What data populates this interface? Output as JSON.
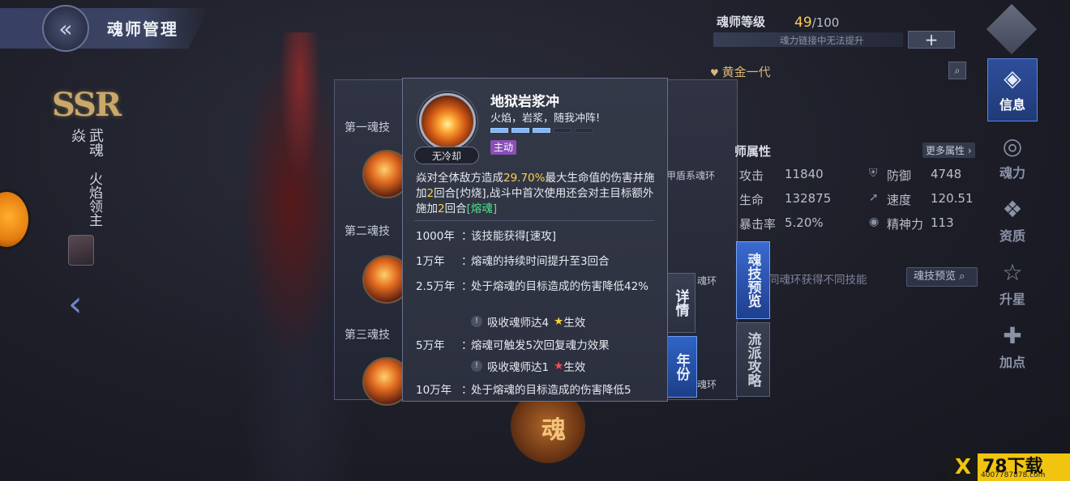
{
  "header": {
    "title": "魂师管理",
    "back_icon": "chevron-left-icon"
  },
  "character": {
    "rarity": "SSR",
    "name": "焱",
    "spirit_label": "武魂",
    "spirit_name": "火焰领主"
  },
  "skill_panel": {
    "slots": [
      {
        "label": "第一魂技"
      },
      {
        "label": "第二魂技"
      },
      {
        "label": "第三魂技"
      }
    ],
    "ring_labels": [
      "甲盾系魂环",
      "魂环",
      "魂环"
    ],
    "detail_tab": "详情",
    "year_tab": "年份"
  },
  "popup": {
    "cooldown": "无冷却",
    "name": "地狱岩浆冲",
    "quote": "火焰，岩浆，随我冲阵!",
    "level_filled": 3,
    "level_total": 5,
    "type_tag": "主动",
    "desc": {
      "part1": "焱对全体敌方造成",
      "pct": "29.70%",
      "part2": "最大生命值的伤害并施加",
      "num1": "2",
      "part3": "回合[灼烧],战斗中首次使用还会对主目标额外施加",
      "num2": "2",
      "part4": "回合",
      "status": "[熔魂]"
    },
    "years": [
      {
        "key": "1000年",
        "text": "该技能获得[速攻]"
      },
      {
        "key": "1万年",
        "text": "熔魂的持续时间提升至3回合"
      },
      {
        "key": "2.5万年",
        "text": "处于熔魂的目标造成的伤害降低42%",
        "req": "吸收魂师达4",
        "req_suffix": "生效",
        "star": "gold"
      },
      {
        "key": "5万年",
        "text": "熔魂可触发5次回复魂力效果",
        "req": "吸收魂师达1",
        "req_suffix": "生效",
        "star": "red"
      },
      {
        "key": "10万年",
        "text": "处于熔魂的目标造成的伤害降低5"
      }
    ],
    "colon": "：",
    "info_mark": "!",
    "star_glyph": "★"
  },
  "right_panel": {
    "level_label": "魂师等级",
    "level_current": "49",
    "level_max": "/100",
    "level_hint": "魂力链接中无法提升",
    "add_glyph": "+",
    "generation": "黄金一代",
    "attr_title": "师属性",
    "more_attr": "更多属性",
    "attributes": [
      {
        "name": "攻击",
        "value": "11840"
      },
      {
        "name": "防御",
        "value": "4748"
      },
      {
        "name": "生命",
        "value": "132875"
      },
      {
        "name": "速度",
        "value": "120.51"
      },
      {
        "name": "暴击率",
        "value": "5.20%"
      },
      {
        "name": "精神力",
        "value": "113"
      }
    ],
    "skill_note": "同魂环获得不同技能",
    "skill_preview_button": "魂技预览",
    "tab_skill_preview": "魂技预览",
    "tab_strategy": "流派攻略"
  },
  "nav": [
    {
      "label": "信息",
      "icon": "info-icon",
      "active": true
    },
    {
      "label": "魂力",
      "icon": "soul-power-icon",
      "active": false
    },
    {
      "label": "资质",
      "icon": "aptitude-icon",
      "active": false
    },
    {
      "label": "升星",
      "icon": "star-icon",
      "active": false
    },
    {
      "label": "加点",
      "icon": "add-point-icon",
      "active": false
    }
  ],
  "bottom": {
    "orb_text": "魂"
  },
  "watermark": {
    "logo": "X",
    "text": "78下载",
    "url": "4007787878.com"
  },
  "colors": {
    "accent_blue": "#2f64c6",
    "highlight_yellow": "#ffd24a",
    "highlight_green": "#4ee48a",
    "tag_purple": "#8a4fb8",
    "level_gold": "#ffcb5a"
  }
}
